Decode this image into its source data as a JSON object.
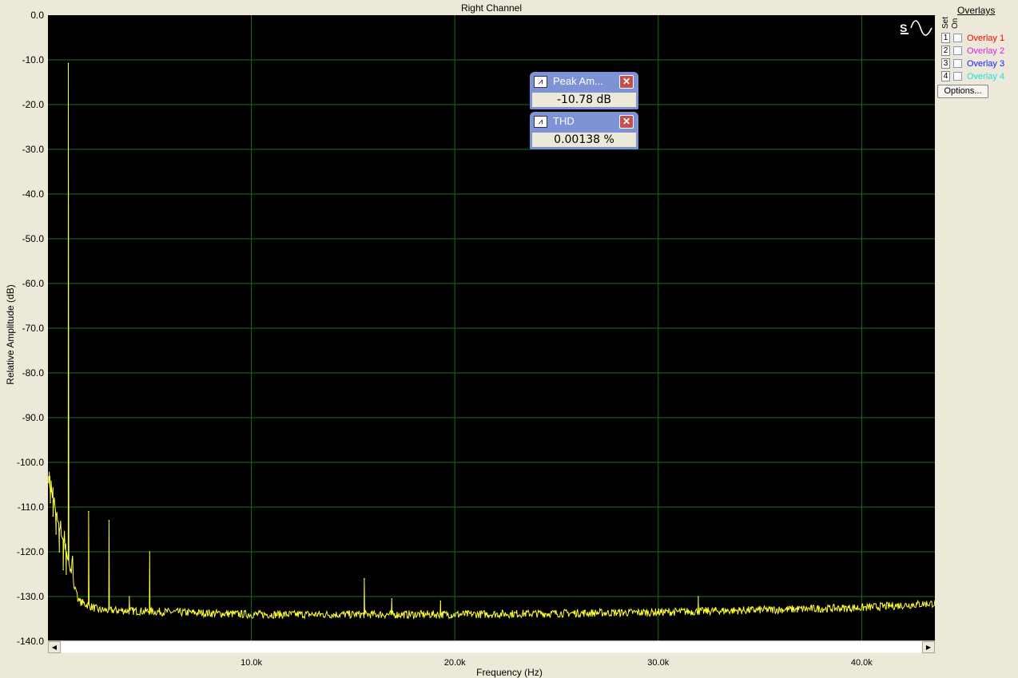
{
  "chart_data": {
    "type": "line",
    "title": "Right Channel",
    "xlabel": "Frequency (Hz)",
    "ylabel": "Relative Amplitude (dB)",
    "xlim": [
      0,
      43600
    ],
    "ylim": [
      -140,
      0
    ],
    "grid": true,
    "y_ticks": [
      "0.0",
      "-10.0",
      "-20.0",
      "-30.0",
      "-40.0",
      "-50.0",
      "-60.0",
      "-70.0",
      "-80.0",
      "-90.0",
      "-100.0",
      "-110.0",
      "-120.0",
      "-130.0",
      "-140.0"
    ],
    "x_ticks": [
      {
        "value": 10000,
        "label": "10.0k"
      },
      {
        "value": 20000,
        "label": "20.0k"
      },
      {
        "value": 30000,
        "label": "30.0k"
      },
      {
        "value": 40000,
        "label": "40.0k"
      }
    ],
    "noise_floor": [
      {
        "x": 0,
        "y": -104
      },
      {
        "x": 1500,
        "y": -131
      },
      {
        "x": 2500,
        "y": -133
      },
      {
        "x": 10000,
        "y": -134
      },
      {
        "x": 20000,
        "y": -134
      },
      {
        "x": 30000,
        "y": -133.5
      },
      {
        "x": 40000,
        "y": -132.5
      },
      {
        "x": 43600,
        "y": -131.5
      }
    ],
    "series": [
      {
        "color": "#ffff33",
        "peaks": [
          {
            "x": 60,
            "y": -104
          },
          {
            "x": 120,
            "y": -109
          },
          {
            "x": 250,
            "y": -112
          },
          {
            "x": 400,
            "y": -116
          },
          {
            "x": 560,
            "y": -120
          },
          {
            "x": 750,
            "y": -124
          },
          {
            "x": 900,
            "y": -125
          },
          {
            "x": 1000,
            "y": -10.8
          },
          {
            "x": 2000,
            "y": -111
          },
          {
            "x": 3000,
            "y": -113
          },
          {
            "x": 4000,
            "y": -130
          },
          {
            "x": 5000,
            "y": -120
          },
          {
            "x": 15550,
            "y": -126
          },
          {
            "x": 16900,
            "y": -130.5
          },
          {
            "x": 19300,
            "y": -131
          },
          {
            "x": 31970,
            "y": -130
          }
        ]
      }
    ]
  },
  "overlays": {
    "title": "Overlays",
    "set_label": "Set",
    "on_label": "On",
    "items": [
      {
        "set": "1",
        "label": "Overlay 1",
        "color": "#ff0000"
      },
      {
        "set": "2",
        "label": "Overlay 2",
        "color": "#e020e0"
      },
      {
        "set": "3",
        "label": "Overlay 3",
        "color": "#1a1aff"
      },
      {
        "set": "4",
        "label": "Overlay 4",
        "color": "#19e0e0"
      }
    ],
    "options_label": "Options..."
  },
  "meters": {
    "peak": {
      "title": "Peak Am...",
      "value": "-10.78 dB"
    },
    "thd": {
      "title": "THD",
      "value": "0.00138 %"
    }
  },
  "icons": {
    "meter": "waveform-icon",
    "close": "close-icon",
    "generator": "sine-wave-icon"
  },
  "colors": {
    "plot_background": "#000000",
    "grid": "#1e6b1e",
    "trace": "#ffff33"
  }
}
